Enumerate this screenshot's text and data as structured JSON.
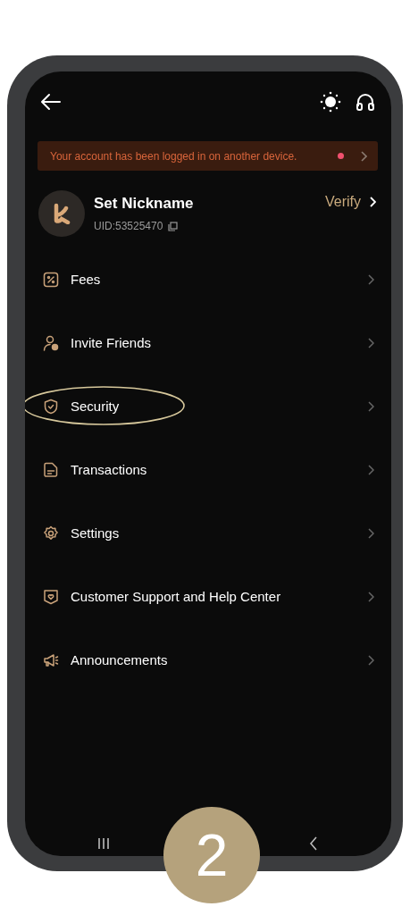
{
  "banner": {
    "text": "Your account has been logged in on another device.",
    "unread": true
  },
  "profile": {
    "name": "Set Nickname",
    "uid": "UID:53525470",
    "verify": "Verify"
  },
  "menu": [
    {
      "label": "Fees",
      "highlighted": false
    },
    {
      "label": "Invite Friends",
      "highlighted": false
    },
    {
      "label": "Security",
      "highlighted": true
    },
    {
      "label": "Transactions",
      "highlighted": false
    },
    {
      "label": "Settings",
      "highlighted": false
    },
    {
      "label": "Customer Support and Help Center",
      "highlighted": false
    },
    {
      "label": "Announcements",
      "highlighted": false
    }
  ],
  "step_badge": "2"
}
